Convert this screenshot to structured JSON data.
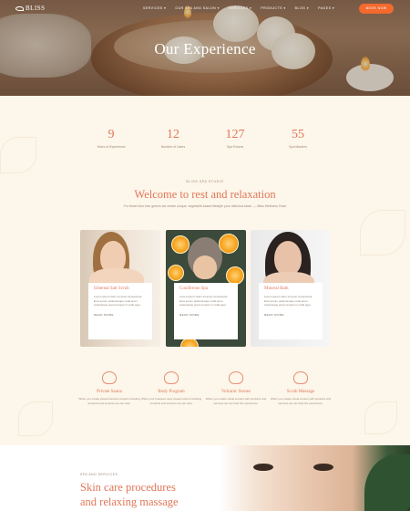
{
  "nav": {
    "logo": "BLISS",
    "menu": [
      "SERVICES ▾",
      "OUR SPA AND SALON ▾",
      "SERVICES ▾",
      "PRODUCTS ▾",
      "BLOG ▾",
      "PAGES ▾"
    ],
    "book_label": "BOOK NOW"
  },
  "hero": {
    "title": "Our Experience"
  },
  "stats": [
    {
      "num": "9",
      "label": "Years of Experience"
    },
    {
      "num": "12",
      "label": "Number of Users"
    },
    {
      "num": "127",
      "label": "Spa Rooms"
    },
    {
      "num": "55",
      "label": "Spa Masters"
    }
  ],
  "welcome": {
    "eyebrow": "BLISS SPA STUDIO",
    "title": "Welcome to rest and relaxation",
    "intro": "For those who love greens we create unique, vegetable-based lifestyle your delicious taste. — Bliss Wellness Team"
  },
  "cards": [
    {
      "title": "Ethereal Salt Scrub",
      "text": "Lorem ipsum dolor sit amet consectetur. Eros ipsum pellentesque nulla amet scelerisque purus tempor in nulla eget.",
      "more": "READ MORE"
    },
    {
      "title": "Coniferous Spa",
      "text": "Lorem ipsum dolor sit amet consectetur. Eros ipsum pellentesque nulla amet scelerisque purus tempor in nulla eget.",
      "more": "READ MORE"
    },
    {
      "title": "Mineral Bath",
      "text": "Lorem ipsum dolor sit amet consectetur. Eros ipsum pellentesque nulla amet scelerisque purus tempor in nulla eget.",
      "more": "READ MORE"
    }
  ],
  "features": [
    {
      "title": "Private Sauna",
      "text": "When you create visual business content including products and services we can help."
    },
    {
      "title": "Body Program",
      "text": "When your business uses visual content including products and services we can help."
    },
    {
      "title": "Volcanic Stones",
      "text": "When you create visual content with products and services we can help the experience."
    },
    {
      "title": "Scrub Massage",
      "text": "When you create visual content with products and services we can help the experience."
    }
  ],
  "bottom": {
    "eyebrow": "SPA AND SERVICES",
    "title_line1": "Skin care procedures",
    "title_line2": "and relaxing massage"
  }
}
